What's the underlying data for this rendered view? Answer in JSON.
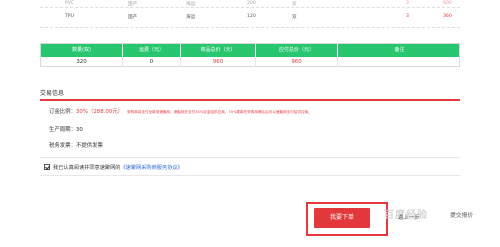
{
  "product_rows": [
    {
      "name": "PVC",
      "origin": "国产",
      "type": "海运",
      "qty": "200",
      "unit": "双",
      "count": "3",
      "price": "600"
    },
    {
      "name": "TPU",
      "origin": "国产",
      "type": "海运",
      "qty": "120",
      "unit": "双",
      "count": "3",
      "price": "360"
    }
  ],
  "summary": {
    "headers": [
      "数量(双)",
      "运费（元）",
      "商品总价（元）",
      "应付总价（元）",
      "备注"
    ],
    "values": [
      "320",
      "0",
      "960",
      "960",
      ""
    ]
  },
  "trade": {
    "title": "交易信息",
    "deposit_label": "订金比例：",
    "deposit_value": "30%（288.00元）",
    "deposit_note": "采购商将支付全款到速聚网，速聚网先支付30%定金给供应商，70%尾款在采购商确认后可以速聚网支付给供应商。",
    "cycle_label": "生产周期：",
    "cycle_value": "30",
    "invoice_label": "税务发票：",
    "invoice_value": "不提供发票"
  },
  "agreement": {
    "text": "我已认真阅读并同意速聚网的",
    "link": "《速聚网采购商服务协议》"
  },
  "actions": {
    "submit": "我要下单",
    "back": "返上一步",
    "quote": "提交报价"
  },
  "watermark": "百度经验",
  "colors": {
    "green": "#28c76f",
    "red": "#e4393c",
    "link": "#2b6cd4"
  }
}
